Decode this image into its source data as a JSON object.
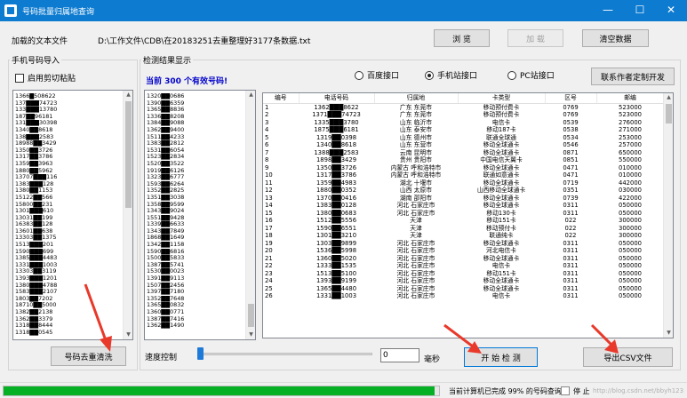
{
  "window": {
    "title": "号码批量归属地查询",
    "minimize": "—",
    "maximize": "☐",
    "close": "✕"
  },
  "file": {
    "label": "加载的文本文件",
    "path": "D:\\工作文件\\CDB\\在20183251去重整理好3177条数据.txt",
    "browse": "浏 览",
    "load": "加 载",
    "clear": "清空数据"
  },
  "import_group": {
    "title": "手机号码导入",
    "checkbox_label": "启用剪切粘贴",
    "checkbox_checked": false,
    "numbers": [
      "1366█508622",
      "137███74723",
      "133███13780",
      "187██96181",
      "131███30398",
      "1340██8618",
      "138███2583",
      "18988██3429",
      "1350██3726",
      "1317██3786",
      "1359██3963",
      "1880██5962",
      "13707███116",
      "1383███128",
      "1380██1153",
      "15122██566",
      "15800██231",
      "1301███610",
      "13031██199",
      "16383██128",
      "13601██638",
      "13303██1375",
      "1513███201",
      "1590███699",
      "1385███4483",
      "1331███1003",
      "13303██3119",
      "1393███1201",
      "1380███4788",
      "1583███2107",
      "1803██7202",
      "18710██5000",
      "1382██2138",
      "1362██3379",
      "1318██8444",
      "1318██0545"
    ],
    "dedupe_button": "号码去重清洗"
  },
  "result_group": {
    "title": "检测结果显示",
    "summary": "当前  300  个有效号码!",
    "interfaces": [
      {
        "label": "百度接口",
        "selected": false
      },
      {
        "label": "手机站接口",
        "selected": true
      },
      {
        "label": "PC站接口",
        "selected": false
      }
    ],
    "contact_button": "联系作者定制开发",
    "valid_numbers": [
      "1320██0686",
      "1390██6359",
      "1365██8836",
      "1336██8208",
      "1384██9088",
      "1362██9400",
      "1511██4233",
      "1383██2812",
      "1531██6054",
      "1523██2834",
      "1520██3522",
      "1919██6126",
      "1323██6777",
      "1593██6264",
      "1352██2825",
      "1351██3038",
      "1358██9599",
      "1343██9024",
      "1551██9428",
      "1339██6633",
      "1343██7849",
      "1868██1649",
      "1342██1158",
      "1590██6816",
      "1500██5833",
      "1387██5741",
      "1530██0023",
      "1391██9113",
      "1507██2456",
      "1397██7180",
      "1352██7648",
      "1365██0832",
      "1360██0771",
      "1387██7416",
      "1362██1490"
    ],
    "columns": [
      "编号",
      "电话号码",
      "归属地",
      "卡类型",
      "区号",
      "邮编"
    ],
    "rows": [
      [
        "1",
        "1362███8622",
        "广东 东莞市",
        "移动预付费卡",
        "0769",
        "523000"
      ],
      [
        "2",
        "1371███74723",
        "广东 东莞市",
        "移动预付费卡",
        "0769",
        "523000"
      ],
      [
        "3",
        "1335███3780",
        "山东 临沂市",
        "电信卡",
        "0539",
        "276000"
      ],
      [
        "4",
        "1875███6181",
        "山东 泰安市",
        "移动187卡",
        "0538",
        "271000"
      ],
      [
        "5",
        "1319██0398",
        "山东 德州市",
        "联通全球通",
        "0534",
        "253000"
      ],
      [
        "6",
        "1340██8618",
        "山东 东营市",
        "移动全球通卡",
        "0546",
        "257000"
      ],
      [
        "7",
        "1388███2583",
        "云南 昆明市",
        "移动全球通卡",
        "0871",
        "650000"
      ],
      [
        "8",
        "1898██3429",
        "贵州 贵阳市",
        "中国电信天翼卡",
        "0851",
        "550000"
      ],
      [
        "9",
        "1350██3726",
        "内蒙古 呼和浩特市",
        "移动全球通卡",
        "0471",
        "010000"
      ],
      [
        "10",
        "1317██3786",
        "内蒙古 呼和浩特市",
        "联通如意通卡",
        "0471",
        "010000"
      ],
      [
        "11",
        "1359██4983",
        "湖北 十堰市",
        "移动全球通卡",
        "0719",
        "442000"
      ],
      [
        "12",
        "1880██0352",
        "山西 太原市",
        "山西移动全球通卡",
        "0351",
        "030000"
      ],
      [
        "13",
        "1370██0416",
        "湖南 邵阳市",
        "移动全球通卡",
        "0739",
        "422000"
      ],
      [
        "14",
        "1383██0128",
        "河北 石家庄市",
        "移动全球通卡",
        "0311",
        "050000"
      ],
      [
        "15",
        "1380██0683",
        "河北 石家庄市",
        "移动130卡",
        "0311",
        "050000"
      ],
      [
        "16",
        "1512██5556",
        "天津",
        "移动151卡",
        "022",
        "300000"
      ],
      [
        "17",
        "1590██6551",
        "天津",
        "移动预付卡",
        "022",
        "300000"
      ],
      [
        "18",
        "1301██3210",
        "天津",
        "联通纯卡",
        "022",
        "300000"
      ],
      [
        "19",
        "1303██9899",
        "河北 石家庄市",
        "移动全球通卡",
        "0311",
        "050000"
      ],
      [
        "20",
        "1536██5998",
        "河北 石家庄市",
        "河北电信卡",
        "0311",
        "050000"
      ],
      [
        "21",
        "1360██5020",
        "河北 石家庄市",
        "移动全球通卡",
        "0311",
        "050000"
      ],
      [
        "22",
        "1333██1535",
        "河北 石家庄市",
        "电信卡",
        "0311",
        "050000"
      ],
      [
        "23",
        "1513██5100",
        "河北 石家庄市",
        "移动151卡",
        "0311",
        "050000"
      ],
      [
        "24",
        "1393██9199",
        "河北 石家庄市",
        "移动全球通卡",
        "0311",
        "050000"
      ],
      [
        "25",
        "1365██4480",
        "河北 石家庄市",
        "移动全球通卡",
        "0311",
        "050000"
      ],
      [
        "26",
        "1331██1003",
        "河北 石家庄市",
        "电信卡",
        "0311",
        "050000"
      ]
    ],
    "speed_label": "速度控制",
    "speed_value": "0",
    "speed_unit": "毫秒",
    "speed_fraction": 0.0,
    "start_button": "开 始 检 测",
    "export_button": "导出CSV文件"
  },
  "status": {
    "text": "当前计算机已完成 99% 的号码查询",
    "percent": 99,
    "stop": "停 止"
  },
  "colors": {
    "title_bar": "#0d7bd0",
    "progress": "#06b025",
    "summary_text": "#0000cc",
    "arrow": "#e8392a"
  },
  "watermark": "http://blog.csdn.net/bbyh123"
}
